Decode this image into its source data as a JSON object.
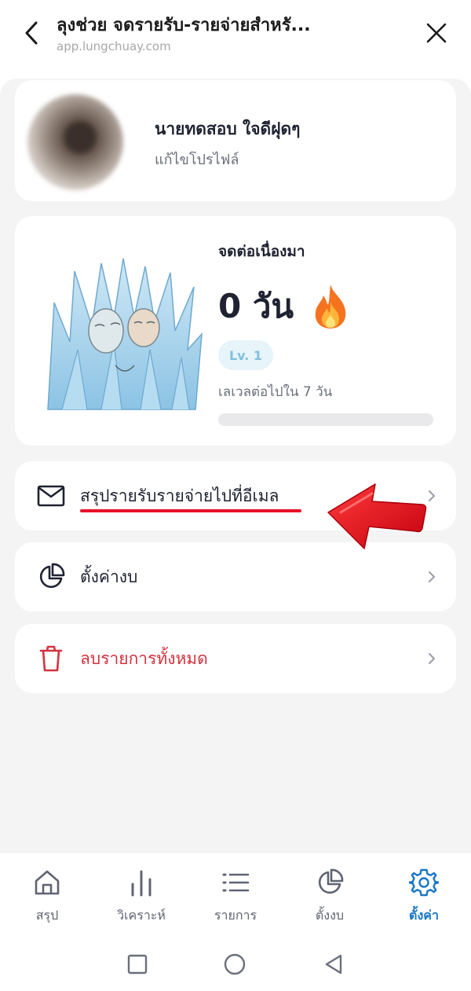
{
  "header": {
    "title": "ลุงช่วย จดรายรับ-รายจ่ายสำหรั...",
    "url": "app.lungchuay.com"
  },
  "profile": {
    "name": "นายทดสอบ ใจดีฝุดๆ",
    "edit_label": "แก้ไขโปรไฟล์"
  },
  "streak": {
    "label": "จดต่อเนื่องมา",
    "days": "0 วัน",
    "level": "Lv. 1",
    "next_level": "เลเวลต่อไปใน 7 วัน",
    "progress": 0
  },
  "menu": {
    "email_summary": "สรุปรายรับรายจ่ายไปที่อีเมล",
    "budget": "ตั้งค่างบ",
    "delete_all": "ลบรายการทั้งหมด"
  },
  "bottom_nav": {
    "items": [
      {
        "label": "สรุป",
        "icon": "home-icon"
      },
      {
        "label": "วิเคราะห์",
        "icon": "bar-chart-icon"
      },
      {
        "label": "รายการ",
        "icon": "list-icon"
      },
      {
        "label": "ตั้งงบ",
        "icon": "pie-chart-icon"
      },
      {
        "label": "ตั้งค่า",
        "icon": "gear-icon"
      }
    ],
    "active_index": 4
  },
  "colors": {
    "accent": "#1976c7",
    "danger": "#d4323f",
    "annotation": "#e8102a",
    "level_badge": "#e7f4fa"
  }
}
